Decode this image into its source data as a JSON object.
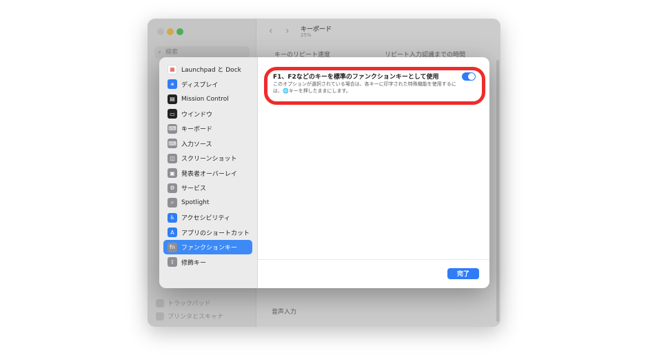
{
  "background_window": {
    "search_placeholder": "検索",
    "title": "キーボード",
    "subtitle": "25%",
    "key_repeat_label": "キーのリピート速度",
    "repeat_delay_label": "リピート入力認識までの時間",
    "voice_input_label": "音声入力",
    "sidebar_items": [
      "トラックパッド",
      "プリンタとスキャナ"
    ]
  },
  "sidebar": {
    "items": [
      {
        "label": "Launchpad と Dock",
        "icon": "launchpad-icon",
        "color": "#ffffff"
      },
      {
        "label": "ディスプレイ",
        "icon": "display-icon",
        "color": "#2f7cf6"
      },
      {
        "label": "Mission Control",
        "icon": "mission-control-icon",
        "color": "#222222"
      },
      {
        "label": "ウインドウ",
        "icon": "window-icon",
        "color": "#222222"
      },
      {
        "label": "キーボード",
        "icon": "keyboard-icon",
        "color": "#8e8e93"
      },
      {
        "label": "入力ソース",
        "icon": "input-source-icon",
        "color": "#8e8e93"
      },
      {
        "label": "スクリーンショット",
        "icon": "screenshot-icon",
        "color": "#8e8e93"
      },
      {
        "label": "発表者オーバーレイ",
        "icon": "presenter-overlay-icon",
        "color": "#8e8e93"
      },
      {
        "label": "サービス",
        "icon": "services-gear-icon",
        "color": "#8e8e93"
      },
      {
        "label": "Spotlight",
        "icon": "spotlight-icon",
        "color": "#8e8e93"
      },
      {
        "label": "アクセシビリティ",
        "icon": "accessibility-icon",
        "color": "#2f7cf6"
      },
      {
        "label": "アプリのショートカット",
        "icon": "app-shortcuts-icon",
        "color": "#2f7cf6"
      },
      {
        "label": "ファンクションキー",
        "icon": "fn-key-icon",
        "color": "#8e8e93"
      },
      {
        "label": "修飾キー",
        "icon": "modifier-key-icon",
        "color": "#8e8e93"
      }
    ],
    "selected_index": 12
  },
  "option": {
    "title": "F1、F2などのキーを標準のファンクションキーとして使用",
    "description": "このオプションが選択されている場合は、各キーに印字された特殊機能を使用するには、🌐キーを押したままにします。",
    "enabled": true
  },
  "done_label": "完了",
  "colors": {
    "accent": "#2f7cf6",
    "highlight": "#ef2b2b",
    "selected_row": "#3d8af7"
  }
}
